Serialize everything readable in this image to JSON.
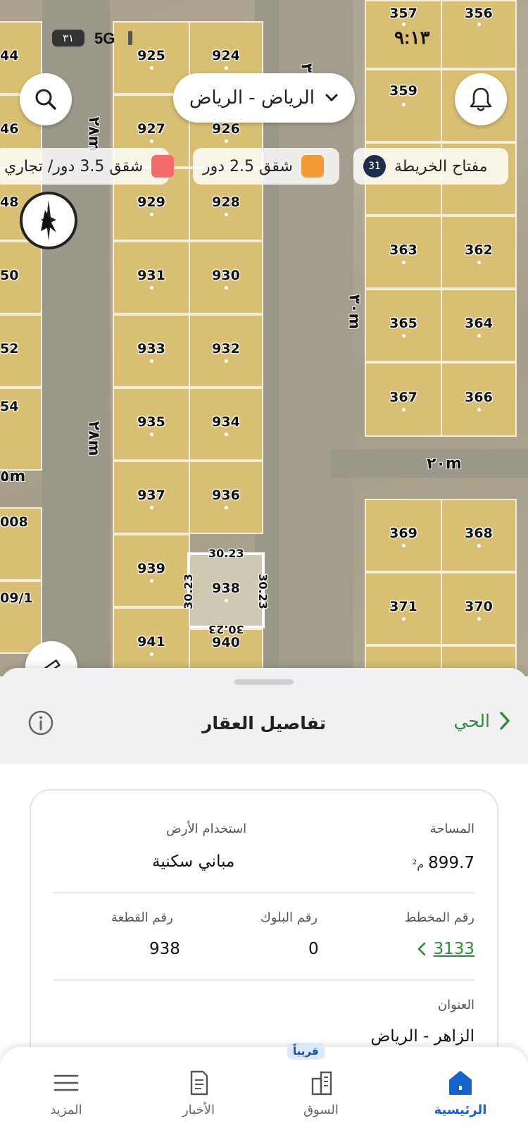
{
  "status_bar": {
    "battery": "٣١",
    "signal": "5G",
    "time": "٩:١٣"
  },
  "map": {
    "city_selector": "الرياض - الرياض",
    "legend": [
      {
        "label": "شقق 3.5 دور/ تجاري",
        "color": "#f36b6b"
      },
      {
        "label": "شقق 2.5 دور",
        "color": "#f29a35"
      },
      {
        "label": "مفتاح الخريطة",
        "count": "31"
      }
    ],
    "plots": [
      "925",
      "924",
      "927",
      "926",
      "929",
      "928",
      "931",
      "930",
      "933",
      "932",
      "935",
      "934",
      "937",
      "936",
      "939",
      "938",
      "941",
      "940",
      "357",
      "356",
      "359",
      "363",
      "362",
      "365",
      "364",
      "367",
      "366",
      "369",
      "368",
      "371",
      "370",
      "44",
      "46",
      "48",
      "50",
      "52",
      "54",
      "008",
      "09/1"
    ],
    "roads": [
      "٢٨m",
      "٢٨m",
      "٣٠m",
      "٣٠m",
      "٢٠m",
      "٥m"
    ],
    "selected_dimensions": {
      "top": "30.23",
      "left": "30.23",
      "right": "30.23",
      "bottom": "30.23"
    }
  },
  "sheet": {
    "title": "تفاصيل العقار",
    "back_link": "الحي",
    "area_label": "المساحة",
    "area_value": "899.7",
    "area_unit": "م²",
    "land_use_label": "استخدام الأرض",
    "land_use_value": "مباني سكنية",
    "plan_label": "رقم المخطط",
    "plan_value": "3133",
    "block_label": "رقم البلوك",
    "block_value": "0",
    "parcel_label": "رقم القطعة",
    "parcel_value": "938",
    "address_label": "العنوان",
    "address_value": "الزاهر - الرياض"
  },
  "tabbar": {
    "items": [
      {
        "label": "الرئيسية",
        "icon": "home-icon",
        "active": true
      },
      {
        "label": "السوق",
        "icon": "buildings-icon",
        "badge": "قريباً"
      },
      {
        "label": "الأخبار",
        "icon": "news-icon"
      },
      {
        "label": "المزيد",
        "icon": "menu-icon"
      }
    ]
  },
  "colors": {
    "accent": "#1763c9",
    "link": "#2e8b3a",
    "plot": "#d8bf73"
  }
}
